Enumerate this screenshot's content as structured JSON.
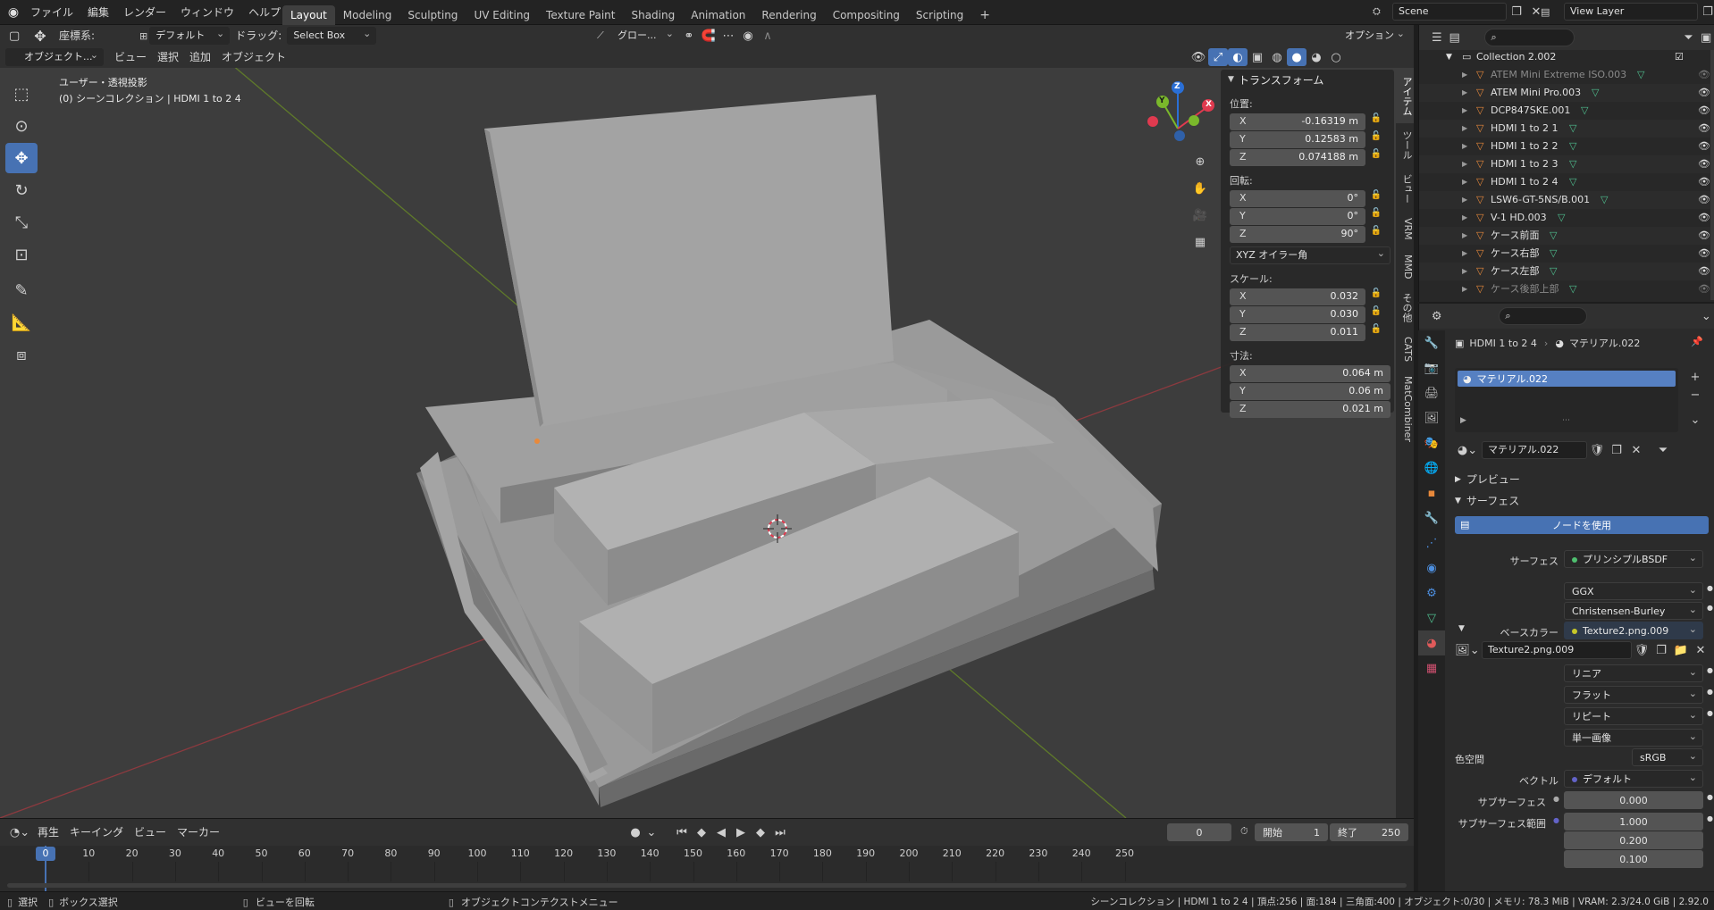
{
  "topbar": {
    "menus": [
      "ファイル",
      "編集",
      "レンダー",
      "ウィンドウ",
      "ヘルプ"
    ],
    "workspaces": [
      "Layout",
      "Modeling",
      "Sculpting",
      "UV Editing",
      "Texture Paint",
      "Shading",
      "Animation",
      "Rendering",
      "Compositing",
      "Scripting"
    ],
    "active_workspace": "Layout",
    "add_workspace": "+",
    "scene_name": "Scene",
    "view_layer": "View Layer"
  },
  "tool_header": {
    "orientation_label": "座標系:",
    "orientation_value": "デフォルト",
    "drag_label": "ドラッグ:",
    "drag_value": "Select Box",
    "transform_global": "グロー...",
    "options_label": "オプション"
  },
  "viewport_header": {
    "mode": "オブジェクト...",
    "menus": [
      "ビュー",
      "選択",
      "追加",
      "オブジェクト"
    ]
  },
  "viewport": {
    "view_name": "ユーザー・透視投影",
    "collection_info": "(0) シーンコレクション | HDMI 1 to 2 4",
    "gizmo_axes": [
      "Z",
      "Y",
      "X"
    ]
  },
  "npanel": {
    "title": "トランスフォーム",
    "location_label": "位置:",
    "location": [
      {
        "axis": "X",
        "value": "-0.16319 m"
      },
      {
        "axis": "Y",
        "value": "0.12583 m"
      },
      {
        "axis": "Z",
        "value": "0.074188 m"
      }
    ],
    "rotation_label": "回転:",
    "rotation": [
      {
        "axis": "X",
        "value": "0°"
      },
      {
        "axis": "Y",
        "value": "0°"
      },
      {
        "axis": "Z",
        "value": "90°"
      }
    ],
    "rotation_mode": "XYZ オイラー角",
    "scale_label": "スケール:",
    "scale": [
      {
        "axis": "X",
        "value": "0.032"
      },
      {
        "axis": "Y",
        "value": "0.030"
      },
      {
        "axis": "Z",
        "value": "0.011"
      }
    ],
    "dimensions_label": "寸法:",
    "dimensions": [
      {
        "axis": "X",
        "value": "0.064 m"
      },
      {
        "axis": "Y",
        "value": "0.06 m"
      },
      {
        "axis": "Z",
        "value": "0.021 m"
      }
    ],
    "tabs": [
      "アイテム",
      "ツール",
      "ビュー",
      "VRM",
      "MMD",
      "その他",
      "CATS",
      "MatCombiner"
    ],
    "active_tab": "アイテム"
  },
  "outliner": {
    "collection": "Collection 2.002",
    "items": [
      {
        "name": "ATEM Mini Extreme ISO.003",
        "dim": true
      },
      {
        "name": "ATEM Mini Pro.003",
        "dim": false
      },
      {
        "name": "DCP847SKE.001",
        "dim": false
      },
      {
        "name": "HDMI 1 to 2 1",
        "dim": false
      },
      {
        "name": "HDMI 1 to 2 2",
        "dim": false
      },
      {
        "name": "HDMI 1 to 2 3",
        "dim": false
      },
      {
        "name": "HDMI 1 to 2 4",
        "dim": false
      },
      {
        "name": "LSW6-GT-5NS/B.001",
        "dim": false
      },
      {
        "name": "V-1 HD.003",
        "dim": false
      },
      {
        "name": "ケース前面",
        "dim": false
      },
      {
        "name": "ケース右部",
        "dim": false
      },
      {
        "name": "ケース左部",
        "dim": false
      },
      {
        "name": "ケース後部上部",
        "dim": true
      }
    ]
  },
  "properties": {
    "object_name": "HDMI 1 to 2 4",
    "material_name": "マテリアル.022",
    "slot_name": "マテリアル.022",
    "material_field": "マテリアル.022",
    "preview_label": "プレビュー",
    "surface_label": "サーフェス",
    "use_nodes": "ノードを使用",
    "surface_field_label": "サーフェス",
    "surface_shader": "プリンシプルBSDF",
    "distribution": "GGX",
    "subsurface_method": "Christensen-Burley",
    "base_color_label": "ベースカラー",
    "base_color_texture": "Texture2.png.009",
    "image_name": "Texture2.png.009",
    "interpolation": "リニア",
    "projection": "フラット",
    "extension": "リピート",
    "source": "単一画像",
    "colorspace_label": "色空間",
    "colorspace": "sRGB",
    "vector_label": "ベクトル",
    "vector_value": "デフォルト",
    "subsurface_label": "サブサーフェス",
    "subsurface_value": "0.000",
    "subsurface_radius_label": "サブサーフェス範囲",
    "subsurface_radius": [
      "1.000",
      "0.200",
      "0.100"
    ]
  },
  "timeline": {
    "menus": [
      "再生",
      "キーイング",
      "ビュー",
      "マーカー"
    ],
    "current_frame": "0",
    "start_label": "開始",
    "start_value": "1",
    "end_label": "終了",
    "end_value": "250",
    "ticks": [
      "0",
      "10",
      "20",
      "30",
      "40",
      "50",
      "60",
      "70",
      "80",
      "90",
      "100",
      "110",
      "120",
      "130",
      "140",
      "150",
      "160",
      "170",
      "180",
      "190",
      "200",
      "210",
      "220",
      "230",
      "240",
      "250"
    ],
    "playhead": "0"
  },
  "statusbar": {
    "select": "選択",
    "box_select": "ボックス選択",
    "rotate_view": "ビューを回転",
    "context_menu": "オブジェクトコンテクストメニュー",
    "stats": "シーンコレクション | HDMI 1 to 2 4 | 頂点:256 | 面:184 | 三角面:400 | オブジェクト:0/30 | メモリ: 78.3 MiB | VRAM: 2.3/24.0 GiB | 2.92.0"
  },
  "colors": {
    "accent": "#4772b3",
    "object_orange": "#e8893b",
    "mesh_green": "#4fbf8f",
    "axis_red": "#e03a4f",
    "axis_green": "#7ab82b",
    "axis_blue": "#2a6fd6"
  }
}
